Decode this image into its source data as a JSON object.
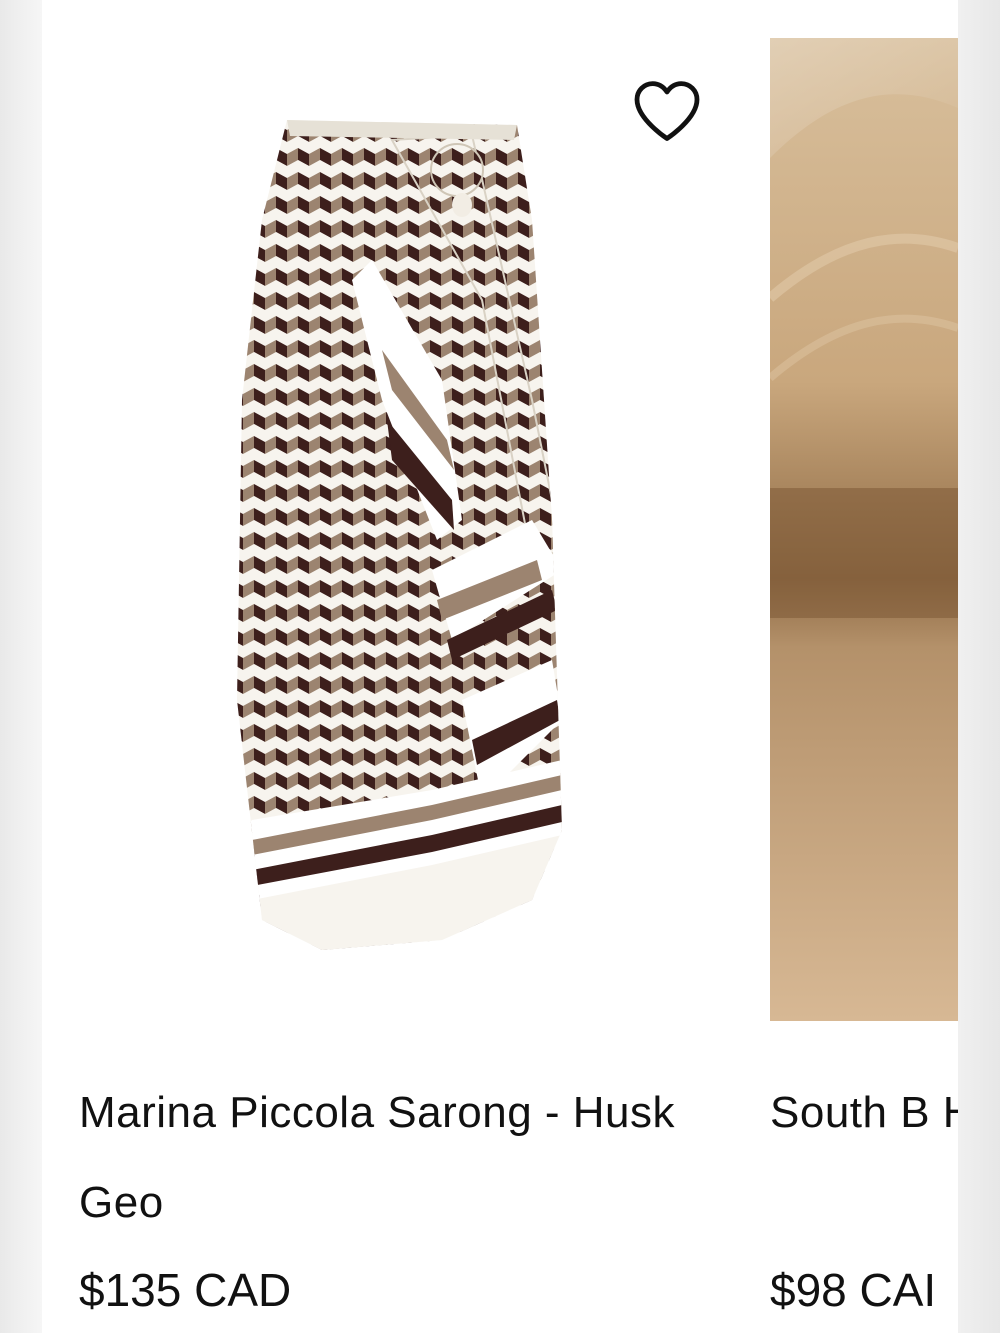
{
  "products": [
    {
      "title": "Marina Piccola Sarong - Husk Geo",
      "price": "$135 CAD",
      "image": "sarong-husk-geo-pattern",
      "wishlist_icon": "heart-outline-icon"
    },
    {
      "title": "South B Husk Ge",
      "price": "$98 CAI",
      "image": "sand-dune-product-photo"
    }
  ],
  "colors": {
    "dark_brown": "#3d1f1c",
    "taupe": "#9c8470",
    "cream": "#f7f4ee",
    "sand": "#c8a680"
  }
}
